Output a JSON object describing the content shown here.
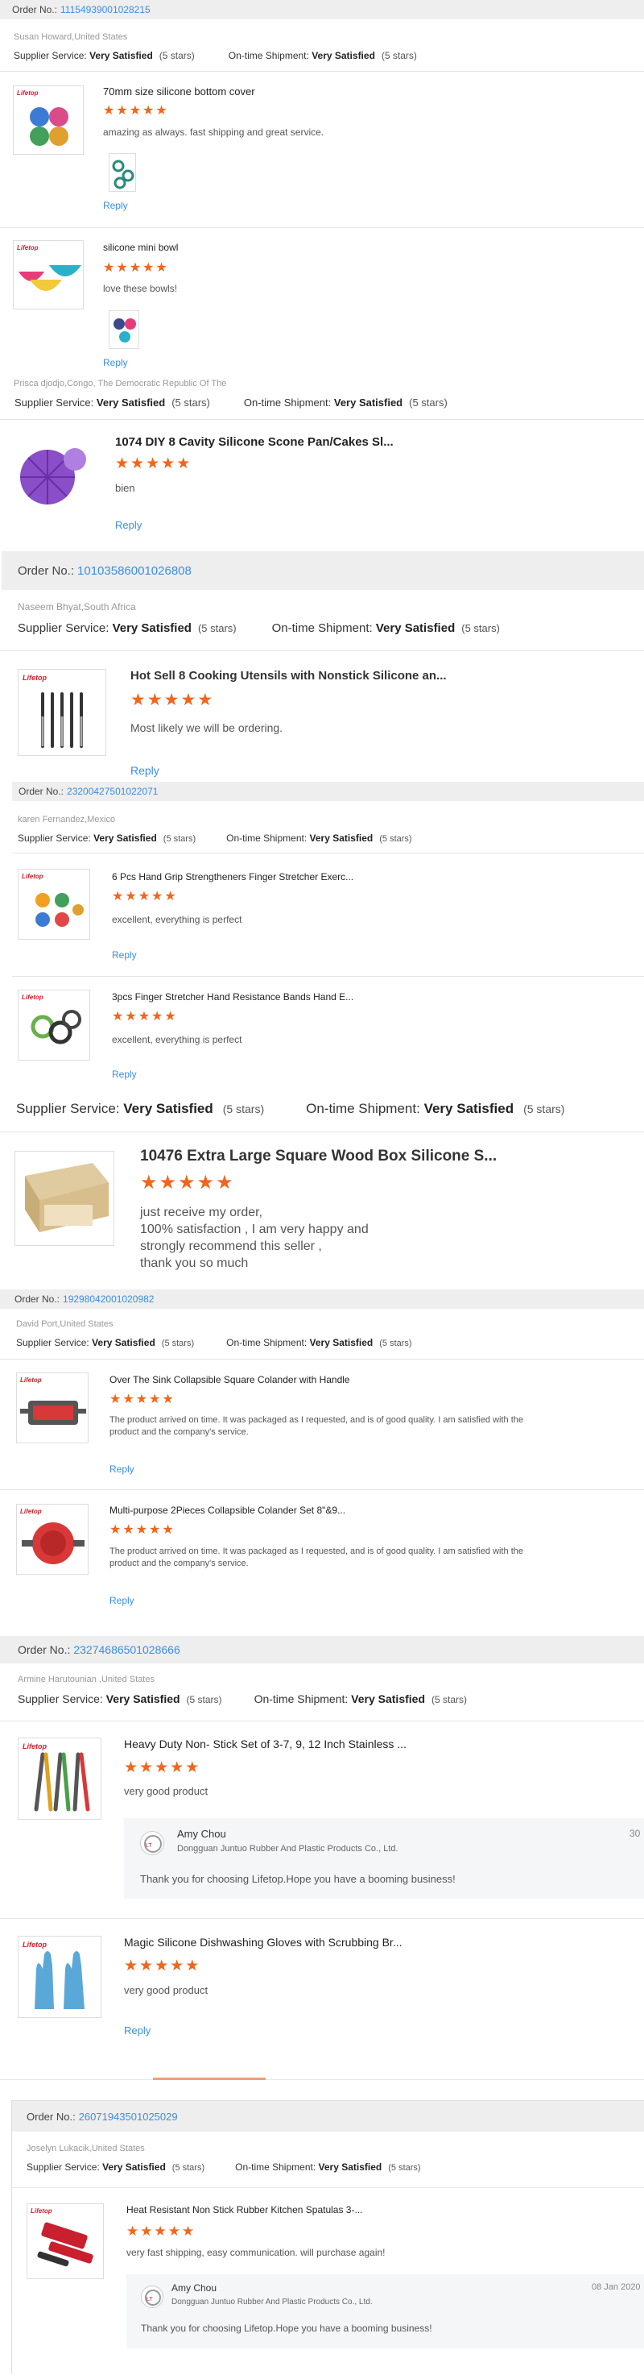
{
  "labels": {
    "order_no": "Order No.:",
    "supplier_service": "Supplier Service:",
    "on_time_shipment": "On-time Shipment:",
    "very_satisfied": "Very Satisfied",
    "five_stars": "(5 stars)",
    "reply": "Reply",
    "logo": "Lifetop"
  },
  "colors": {
    "accent_link": "#3a8ee6",
    "star": "#f0661c",
    "order_bar": "#eeeeee",
    "divider_orange": "#f0661c"
  },
  "orders": [
    {
      "order_number": "1115493900102821​5",
      "buyer": "Susan Howard,United States",
      "items": [
        {
          "title": "70mm size silicone bottom cover",
          "comment": "amazing as always. fast shipping and great service."
        },
        {
          "title": "silicone mini bowl",
          "comment": "love these bowls!"
        }
      ]
    },
    {
      "buyer": "Prisca djodjo,Congo, The Democratic Republic Of The",
      "items": [
        {
          "title": "1074 DIY 8 Cavity Silicone Scone Pan/Cakes Sl...",
          "comment": "bien"
        }
      ]
    },
    {
      "order_number": "10103586001026808",
      "buyer": "Naseem Bhyat,South Africa",
      "items": [
        {
          "title": "Hot Sell 8 Cooking Utensils with Nonstick Silicone an...",
          "comment": "Most likely we will be ordering."
        }
      ]
    },
    {
      "order_number": "23200427501022071",
      "buyer": "karen Fernandez,Mexico",
      "items": [
        {
          "title": "6 Pcs Hand Grip Strengtheners Finger Stretcher Exerc...",
          "comment": "excellent, everything is perfect"
        },
        {
          "title": "3pcs Finger Stretcher Hand Resistance Bands Hand E...",
          "comment": "excellent, everything is perfect"
        }
      ]
    },
    {
      "items": [
        {
          "title": "10476 Extra Large Square Wood Box Silicone S...",
          "comment_lines": [
            "just receive my order,",
            "100% satisfaction , I am very happy and",
            "strongly recommend this seller ,",
            "thank you so much"
          ]
        }
      ]
    },
    {
      "order_number": "19298042001020982",
      "buyer": "David Port,United States",
      "items": [
        {
          "title": "Over The Sink Collapsible Square Colander with Handle",
          "comment_lines": [
            "The product arrived on time. It was packaged as I requested, and is of good quality. I am satisfied with the",
            "product and the company's service."
          ]
        },
        {
          "title": "Multi-purpose 2Pieces Collapsible Colander Set 8\"&9...",
          "comment_lines": [
            "The product arrived on time. It was packaged as I requested, and is of good quality. I am satisfied with the",
            "product and the company's service."
          ]
        }
      ]
    },
    {
      "order_number": "23274686501028666",
      "buyer": "Armine Harutounian ,United States",
      "items": [
        {
          "title": "Heavy Duty Non- Stick Set of 3-7, 9, 12 Inch Stainless ...",
          "comment": "very good product",
          "seller_reply": {
            "name": "Amy Chou",
            "company": "Dongguan Juntuo Rubber And Plastic Products Co., Ltd.",
            "message": "Thank you for choosing Lifetop.Hope you have a booming business!",
            "date": "30"
          }
        },
        {
          "title": "Magic Silicone Dishwashing Gloves with Scrubbing Br...",
          "comment": "very good product"
        }
      ]
    },
    {
      "order_number": "26071943501025029",
      "buyer": "Joselyn Lukacik,United States",
      "items": [
        {
          "title": "Heat Resistant Non Stick Rubber Kitchen Spatulas 3-...",
          "comment": "very fast shipping, easy communication. will purchase again!",
          "seller_reply": {
            "name": "Amy Chou",
            "company": "Dongguan Juntuo Rubber And Plastic Products Co., Ltd.",
            "message": "Thank you for choosing Lifetop.Hope you have a booming business!",
            "date": "08 Jan 2020"
          }
        }
      ]
    }
  ]
}
